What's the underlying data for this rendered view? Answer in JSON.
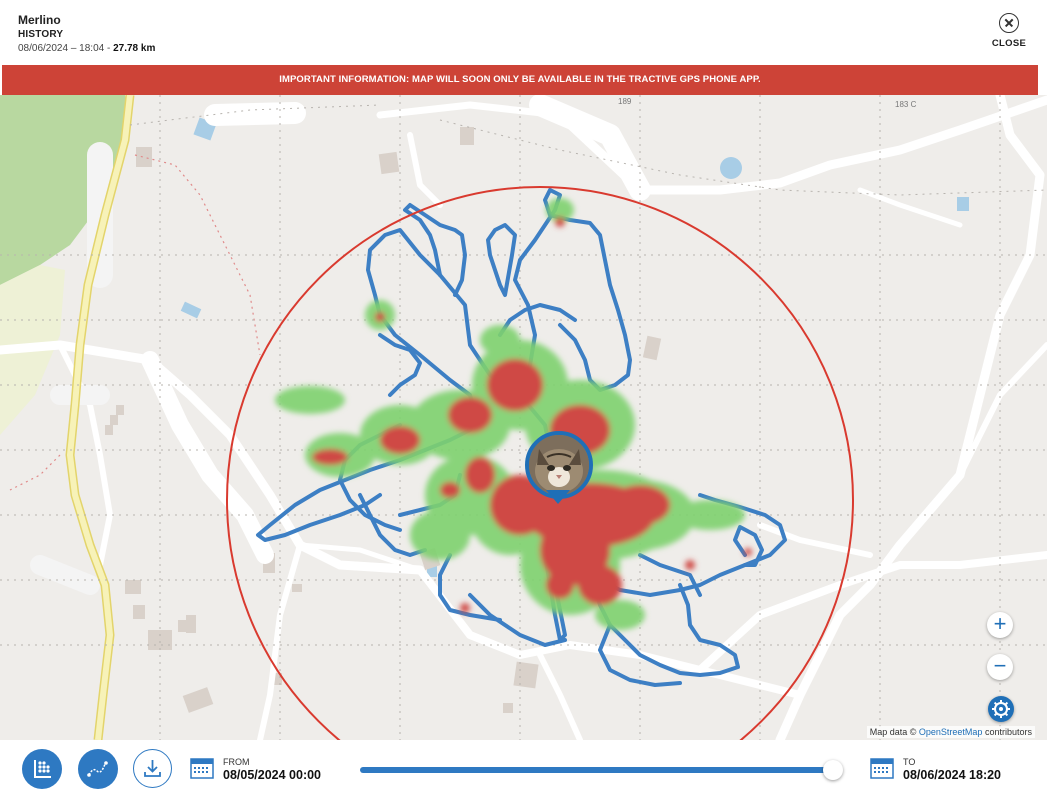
{
  "header": {
    "pet_name": "Merlino",
    "section": "HISTORY",
    "date_range": "08/06/2024 – 18:04 - ",
    "distance": "27.78 km",
    "close_label": "CLOSE"
  },
  "banner": {
    "text": "IMPORTANT INFORMATION: MAP WILL SOON ONLY BE AVAILABLE IN THE TRACTIVE GPS PHONE APP."
  },
  "map": {
    "labels": [
      "189",
      "183 C"
    ],
    "attribution_prefix": "Map data ©",
    "attribution_link": "OpenStreetMap",
    "attribution_suffix": "contributors",
    "zoom_in": "+",
    "zoom_out": "−",
    "colors": {
      "track": "#3d7fc4",
      "heat_low": "#6dcf6a",
      "heat_high": "#cf4a45",
      "geofence": "#d93a2f"
    }
  },
  "footer": {
    "from_label": "FROM",
    "from_value": "08/05/2024 00:00",
    "to_label": "TO",
    "to_value": "08/06/2024 18:20",
    "slider_fraction": 1.0,
    "buttons": [
      "heatmap-icon",
      "route-icon",
      "download-icon"
    ]
  },
  "colors": {
    "brand": "#2e79c2",
    "banner": "#cd4337"
  }
}
